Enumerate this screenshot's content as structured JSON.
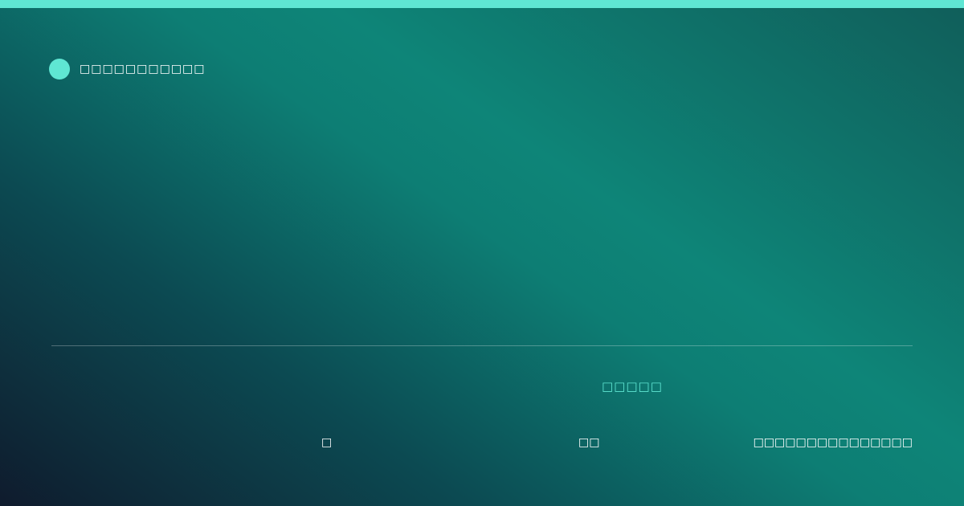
{
  "brand": {
    "name": "□□□□□□□□□□□",
    "accent_color": "#5fe6d3",
    "icon": "circle-logo-icon"
  },
  "tagline": "□□□□□",
  "footer": {
    "item_1": "□",
    "item_2": "□□",
    "item_3": "□□□□□□□□□□□□□□□"
  },
  "colors": {
    "background_dark": "#0f1b2d",
    "background_teal": "#0d7e74",
    "text": "#ffffff"
  }
}
